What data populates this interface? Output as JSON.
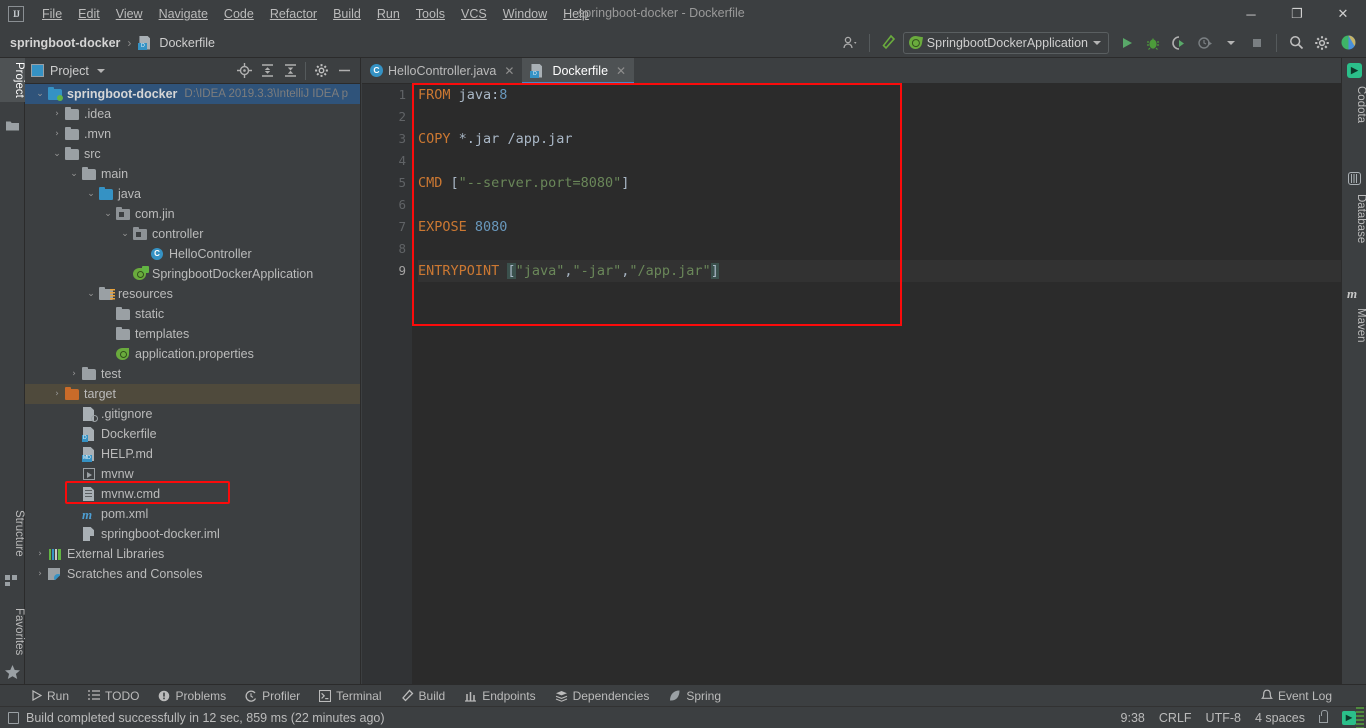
{
  "window": {
    "title": "springboot-docker - Dockerfile",
    "minimize": "─",
    "maximize": "❐",
    "close": "✕"
  },
  "menu": [
    {
      "label": "File"
    },
    {
      "label": "Edit"
    },
    {
      "label": "View"
    },
    {
      "label": "Navigate"
    },
    {
      "label": "Code"
    },
    {
      "label": "Refactor"
    },
    {
      "label": "Build"
    },
    {
      "label": "Run"
    },
    {
      "label": "Tools"
    },
    {
      "label": "VCS"
    },
    {
      "label": "Window"
    },
    {
      "label": "Help"
    }
  ],
  "navbar": {
    "project": "springboot-docker",
    "separator": "›",
    "file": "Dockerfile",
    "file_icon": "dockerfile-icon",
    "file_icon_badge": "D",
    "run_config": "SpringbootDockerApplication",
    "icons": {
      "user": "user-icon",
      "hammer": "build-hammer-icon",
      "run": "run-icon",
      "debug": "debug-icon",
      "run_with_coverage": "coverage-icon",
      "profile": "profile-icon",
      "stop": "stop-icon",
      "search": "search-everywhere-icon",
      "settings": "settings-gear-icon",
      "updates": "updates-icon"
    }
  },
  "left_strip": {
    "top": [
      {
        "label": "Project",
        "active": true
      }
    ],
    "bottom": [
      {
        "label": "Structure"
      },
      {
        "label": "Favorites"
      }
    ]
  },
  "right_strip": [
    {
      "label": "Codota"
    },
    {
      "label": "Database"
    },
    {
      "label": "Maven"
    }
  ],
  "project_panel": {
    "title": "Project",
    "icons": [
      "locate-icon",
      "expand-all-icon",
      "collapse-all-icon",
      "settings-gear-icon",
      "hide-icon"
    ],
    "tree": [
      {
        "indent": 0,
        "twisty": "⌄",
        "icon": "module-folder",
        "label": "springboot-docker",
        "path": "D:\\IDEA 2019.3.3\\IntelliJ IDEA p",
        "bold": true,
        "state": "root-selected"
      },
      {
        "indent": 1,
        "twisty": "›",
        "icon": "folder-gray",
        "label": ".idea"
      },
      {
        "indent": 1,
        "twisty": "›",
        "icon": "folder-gray",
        "label": ".mvn"
      },
      {
        "indent": 1,
        "twisty": "⌄",
        "icon": "folder-gray",
        "label": "src"
      },
      {
        "indent": 2,
        "twisty": "⌄",
        "icon": "folder-gray",
        "label": "main"
      },
      {
        "indent": 3,
        "twisty": "⌄",
        "icon": "folder-blue",
        "label": "java"
      },
      {
        "indent": 4,
        "twisty": "⌄",
        "icon": "package",
        "label": "com.jin"
      },
      {
        "indent": 5,
        "twisty": "⌄",
        "icon": "package",
        "label": "controller"
      },
      {
        "indent": 6,
        "twisty": "",
        "icon": "class",
        "label": "HelloController"
      },
      {
        "indent": 5,
        "twisty": "",
        "icon": "spring-app",
        "label": "SpringbootDockerApplication"
      },
      {
        "indent": 3,
        "twisty": "⌄",
        "icon": "folder-resources",
        "label": "resources"
      },
      {
        "indent": 4,
        "twisty": "",
        "icon": "folder-gray",
        "label": "static"
      },
      {
        "indent": 4,
        "twisty": "",
        "icon": "folder-gray",
        "label": "templates"
      },
      {
        "indent": 4,
        "twisty": "",
        "icon": "spring-properties",
        "label": "application.properties"
      },
      {
        "indent": 2,
        "twisty": "›",
        "icon": "folder-gray",
        "label": "test"
      },
      {
        "indent": 1,
        "twisty": "›",
        "icon": "folder-orange",
        "label": "target",
        "state": "amber-selected"
      },
      {
        "indent": 2,
        "twisty": "",
        "icon": "gitignore-file",
        "label": ".gitignore"
      },
      {
        "indent": 2,
        "twisty": "",
        "icon": "dockerfile-file",
        "label": "Dockerfile",
        "badge": "D",
        "highlighted": true
      },
      {
        "indent": 2,
        "twisty": "",
        "icon": "markdown-file",
        "label": "HELP.md",
        "badge": "MD"
      },
      {
        "indent": 2,
        "twisty": "",
        "icon": "script-file",
        "label": "mvnw"
      },
      {
        "indent": 2,
        "twisty": "",
        "icon": "cmd-file",
        "label": "mvnw.cmd"
      },
      {
        "indent": 2,
        "twisty": "",
        "icon": "maven-file",
        "label": "pom.xml"
      },
      {
        "indent": 2,
        "twisty": "",
        "icon": "iml-file",
        "label": "springboot-docker.iml"
      },
      {
        "indent": 0,
        "twisty": "›",
        "icon": "libraries",
        "label": "External Libraries"
      },
      {
        "indent": 0,
        "twisty": "›",
        "icon": "scratches",
        "label": "Scratches and Consoles"
      }
    ]
  },
  "editor": {
    "tabs": [
      {
        "label": "HelloController.java",
        "icon": "java-class-icon",
        "active": false,
        "close": "✕"
      },
      {
        "label": "Dockerfile",
        "icon": "dockerfile-icon",
        "badge": "D",
        "active": true,
        "close": "✕"
      }
    ],
    "inspection_status": "✔",
    "line_numbers": [
      "1",
      "2",
      "3",
      "4",
      "5",
      "6",
      "7",
      "8",
      "9"
    ],
    "current_line": 9,
    "run_gutter_line": 1,
    "lines": [
      {
        "n": 1,
        "tokens": [
          {
            "t": "FROM",
            "c": "kw"
          },
          {
            "t": " ",
            "c": "plain"
          },
          {
            "t": "java:",
            "c": "plain"
          },
          {
            "t": "8",
            "c": "num"
          }
        ]
      },
      {
        "n": 2,
        "tokens": []
      },
      {
        "n": 3,
        "tokens": [
          {
            "t": "COPY",
            "c": "kw"
          },
          {
            "t": " ",
            "c": "plain"
          },
          {
            "t": "*",
            "c": "plain"
          },
          {
            "t": ".jar ",
            "c": "plain"
          },
          {
            "t": "/app.jar",
            "c": "plain"
          }
        ]
      },
      {
        "n": 4,
        "tokens": []
      },
      {
        "n": 5,
        "tokens": [
          {
            "t": "CMD",
            "c": "kw"
          },
          {
            "t": " ",
            "c": "plain"
          },
          {
            "t": "[",
            "c": "punct"
          },
          {
            "t": "\"--server.port=8080\"",
            "c": "str"
          },
          {
            "t": "]",
            "c": "punct"
          }
        ]
      },
      {
        "n": 6,
        "tokens": []
      },
      {
        "n": 7,
        "tokens": [
          {
            "t": "EXPOSE",
            "c": "kw"
          },
          {
            "t": " ",
            "c": "plain"
          },
          {
            "t": "8080",
            "c": "num"
          }
        ]
      },
      {
        "n": 8,
        "tokens": []
      },
      {
        "n": 9,
        "tokens": [
          {
            "t": "ENTRYPOINT",
            "c": "kw"
          },
          {
            "t": " ",
            "c": "plain"
          },
          {
            "t": "[",
            "c": "brk"
          },
          {
            "t": "\"java\"",
            "c": "str"
          },
          {
            "t": ",",
            "c": "punct"
          },
          {
            "t": "\"-jar\"",
            "c": "str"
          },
          {
            "t": ",",
            "c": "punct"
          },
          {
            "t": "\"/app.jar\"",
            "c": "str"
          },
          {
            "t": "]",
            "c": "brk"
          }
        ]
      }
    ]
  },
  "tool_windows": [
    {
      "label": "Run",
      "icon": "run-icon"
    },
    {
      "label": "TODO",
      "icon": "todo-icon"
    },
    {
      "label": "Problems",
      "icon": "problems-icon"
    },
    {
      "label": "Profiler",
      "icon": "profiler-icon"
    },
    {
      "label": "Terminal",
      "icon": "terminal-icon"
    },
    {
      "label": "Build",
      "icon": "build-hammer-icon"
    },
    {
      "label": "Endpoints",
      "icon": "endpoints-icon"
    },
    {
      "label": "Dependencies",
      "icon": "dependencies-icon"
    },
    {
      "label": "Spring",
      "icon": "spring-leaf-icon"
    }
  ],
  "event_log": {
    "label": "Event Log",
    "icon": "bell-icon"
  },
  "status": {
    "message": "Build completed successfully in 12 sec, 859 ms (22 minutes ago)",
    "caret": "9:38",
    "line_separator": "CRLF",
    "encoding": "UTF-8",
    "indent": "4 spaces",
    "lock": "lock-icon",
    "terminal": "terminal-icon"
  },
  "colors": {
    "accent_blue": "#4a88c7",
    "keyword_orange": "#cc7832",
    "string_green": "#6a8759",
    "number_blue": "#6897bb",
    "highlight_red": "#fb0b0b",
    "selection_blue": "#2f537a",
    "editor_bg": "#2b2b2b",
    "panel_bg": "#3c3f41",
    "success_green": "#59a869"
  }
}
